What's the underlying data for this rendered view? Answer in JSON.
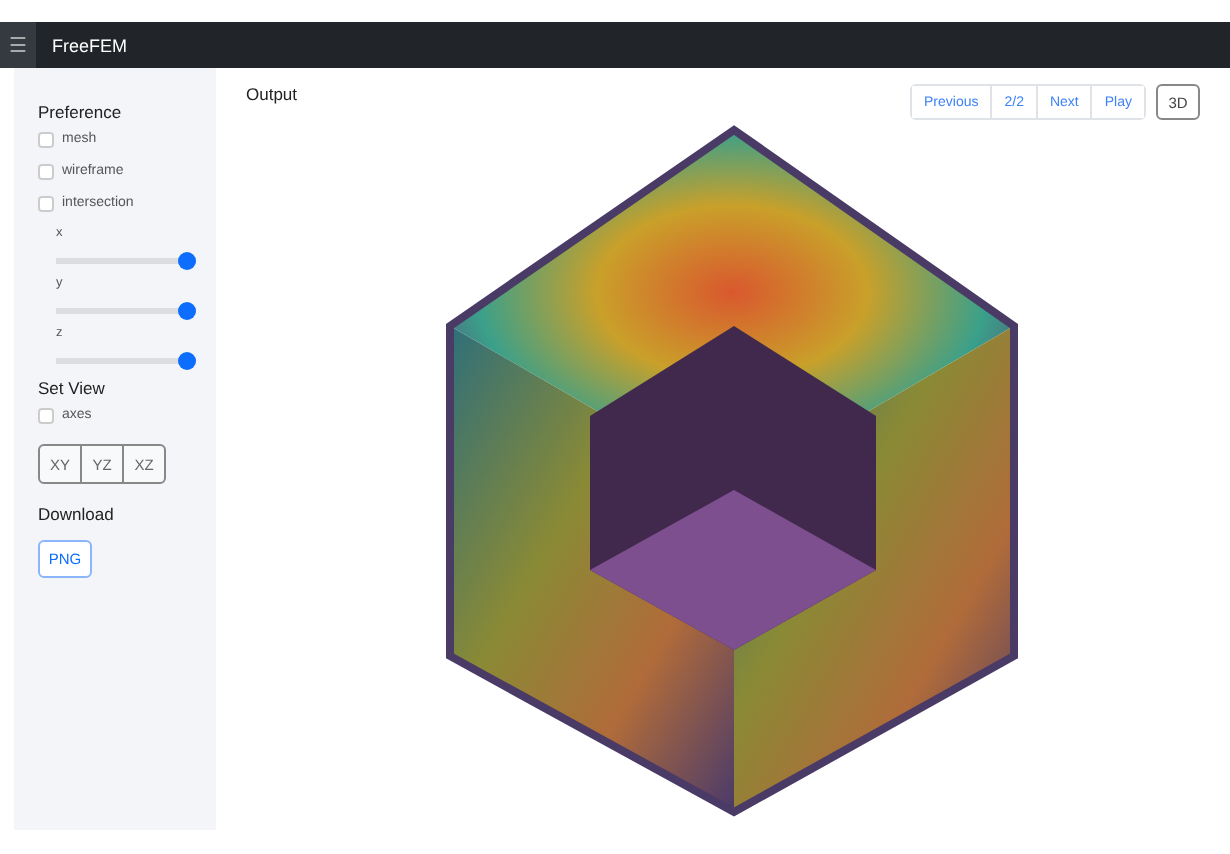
{
  "header": {
    "menu_icon": "☰",
    "title": "FreeFEM"
  },
  "sidebar": {
    "sections": [
      {
        "title": "Preference",
        "items": [
          {
            "kind": "checkbox",
            "label": "mesh",
            "checked": false
          },
          {
            "kind": "checkbox",
            "label": "wireframe",
            "checked": false
          },
          {
            "kind": "checkbox",
            "label": "intersection",
            "checked": false
          },
          {
            "kind": "slider",
            "label": "x",
            "level": 1
          },
          {
            "kind": "slider",
            "label": "y",
            "level": 1
          },
          {
            "kind": "slider",
            "label": "z",
            "level": 1
          }
        ]
      },
      {
        "title": "Set View",
        "items": [
          {
            "kind": "checkbox",
            "label": "axes",
            "checked": false
          },
          {
            "kind": "buttons",
            "labels": [
              "XY",
              "YZ",
              "XZ"
            ]
          }
        ]
      },
      {
        "title": "Download",
        "items": [
          {
            "kind": "download",
            "labels": [
              "PNG"
            ]
          }
        ]
      }
    ]
  },
  "main": {
    "title": "Output",
    "nav_buttons": [
      "Previous",
      "2/2",
      "Next",
      "Play"
    ],
    "mode_button": "3D"
  }
}
